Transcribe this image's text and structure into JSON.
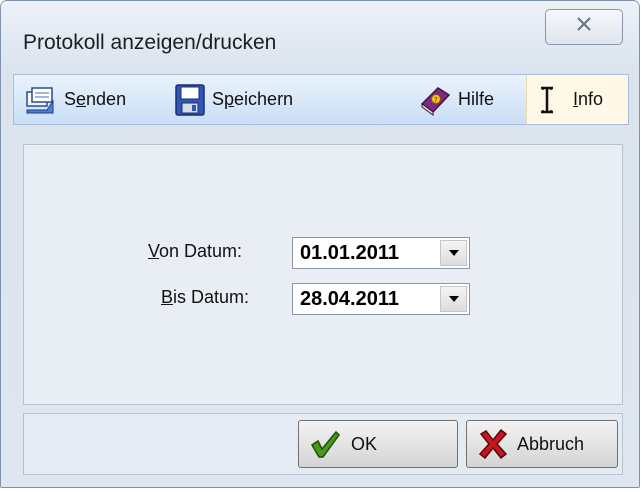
{
  "window": {
    "title": "Protokoll anzeigen/drucken",
    "close_glyph": "☒"
  },
  "toolbar": {
    "senden": {
      "pre": "S",
      "u": "e",
      "post": "nden",
      "icon": "send-icon"
    },
    "speichern": {
      "pre": "S",
      "u": "p",
      "post": "eichern",
      "icon": "floppy-disk-icon"
    },
    "hilfe": {
      "label": "Hilfe",
      "icon": "help-book-icon"
    },
    "info": {
      "pre": "",
      "u": "I",
      "post": "nfo",
      "icon": "info-cursor-icon"
    }
  },
  "form": {
    "von": {
      "u": "V",
      "post": "on Datum:",
      "value": "01.01.2011"
    },
    "bis": {
      "u": "B",
      "post": "is Datum:",
      "value": "28.04.2011"
    }
  },
  "buttons": {
    "ok": {
      "label": "OK",
      "icon": "checkmark-icon"
    },
    "abbruch": {
      "label": "Abbruch",
      "icon": "red-x-icon"
    }
  },
  "colors": {
    "toolbar_bg": "#c9def5",
    "ok_green": "#4a9a1a",
    "cancel_red": "#c8161e"
  }
}
